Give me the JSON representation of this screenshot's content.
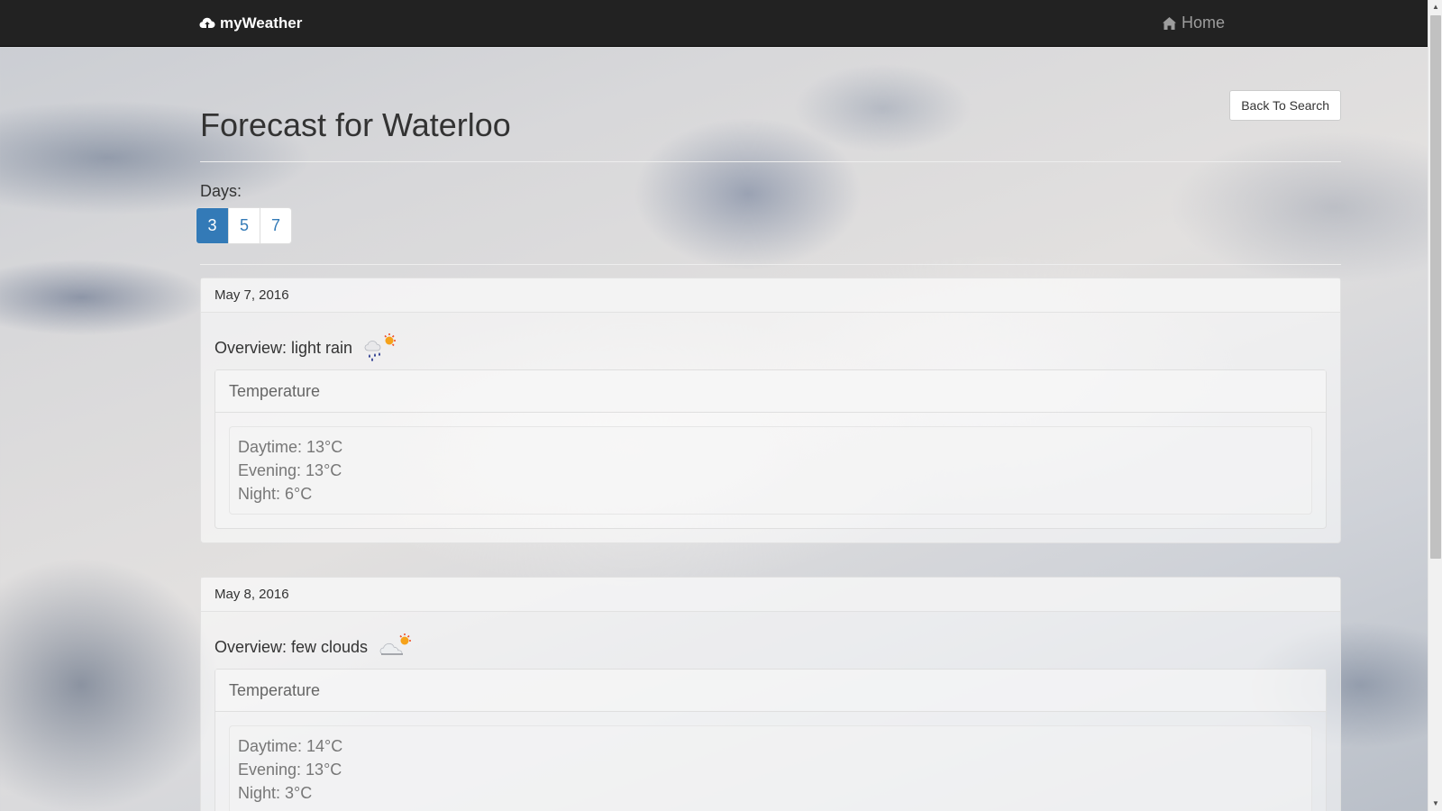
{
  "navbar": {
    "brand": "myWeather",
    "brand_icon": "cloud-upload-icon",
    "home_label": "Home",
    "home_icon": "home-icon"
  },
  "header": {
    "title": "Forecast for Waterloo",
    "back_button": "Back To Search"
  },
  "days": {
    "label": "Days:",
    "options": [
      "3",
      "5",
      "7"
    ],
    "selected": "3"
  },
  "forecasts": [
    {
      "date": "May 7, 2016",
      "overview": "Overview: light rain",
      "icon": "rain-sun-icon",
      "temperature_heading": "Temperature",
      "daytime": "Daytime: 13°C",
      "evening": "Evening: 13°C",
      "night": "Night: 6°C"
    },
    {
      "date": "May 8, 2016",
      "overview": "Overview: few clouds",
      "icon": "cloud-sun-icon",
      "temperature_heading": "Temperature",
      "daytime": "Daytime: 14°C",
      "evening": "Evening: 13°C",
      "night": "Night: 3°C"
    }
  ],
  "colors": {
    "navbar_bg": "#222222",
    "accent": "#337ab7"
  }
}
